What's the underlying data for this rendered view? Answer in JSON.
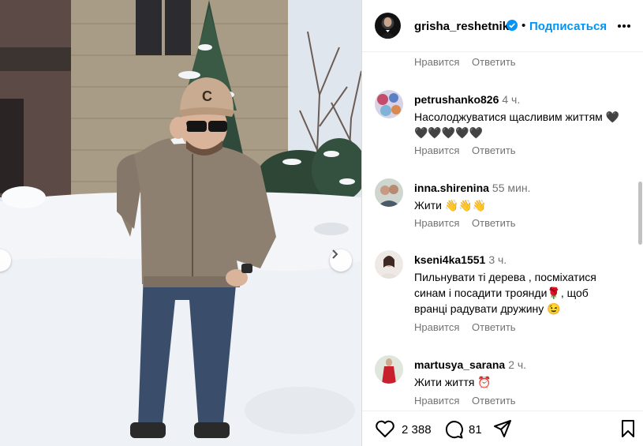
{
  "post": {
    "author": "grisha_reshetnik",
    "follow_label": "Подписаться",
    "separator": "•",
    "likes": "2 388",
    "comments_count": "81"
  },
  "actions": {
    "like": "Нравится",
    "reply": "Ответить"
  },
  "comments": [
    {
      "user": "petrushanko826",
      "time": "4 ч.",
      "text": "Насолоджуватися щасливим життям 🖤🖤🖤🖤🖤🖤"
    },
    {
      "user": "inna.shirenina",
      "time": "55 мин.",
      "text": "Жити 👋👋👋"
    },
    {
      "user": "kseni4ka1551",
      "time": "3 ч.",
      "text": "Пильнувати ті дерева , посміхатися синам і посадити троянди🌹, щоб вранці радувати дружину 😉"
    },
    {
      "user": "martusya_sarana",
      "time": "2 ч.",
      "text": "Жити життя ⏰"
    }
  ],
  "colors": {
    "accent": "#0095f6",
    "muted": "#737373",
    "border": "#dbdbdb"
  },
  "icons": [
    "verified-badge-icon",
    "more-options-icon",
    "heart-icon",
    "comment-icon",
    "share-icon",
    "bookmark-icon",
    "chevron-right-icon",
    "chevron-left-icon"
  ]
}
